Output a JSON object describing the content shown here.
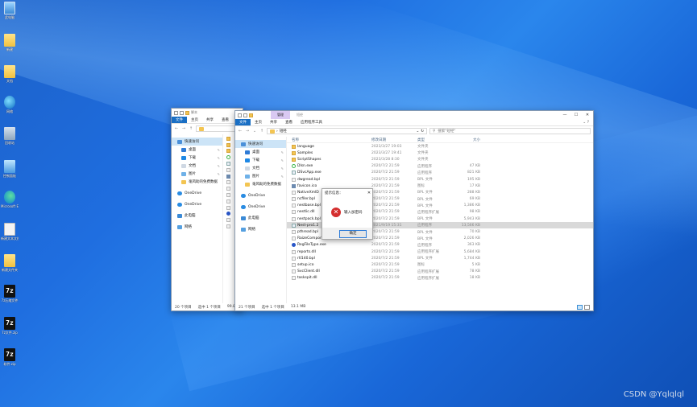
{
  "desktop": {
    "icons": [
      {
        "label": "此电脑",
        "icon": "this-pc-icon"
      },
      {
        "label": "新建",
        "icon": "folder-icon"
      },
      {
        "label": "文档",
        "icon": "folder-icon"
      },
      {
        "label": "网络",
        "icon": "network-icon"
      },
      {
        "label": "回收站",
        "icon": "recycle-bin-icon"
      },
      {
        "label": "控制面板",
        "icon": "control-panel-icon"
      },
      {
        "label": "Microsoft Edge",
        "icon": "edge-icon"
      },
      {
        "label": "新建文本文档.txt",
        "icon": "text-file-icon"
      },
      {
        "label": "新建文件夹",
        "icon": "folder-icon"
      },
      {
        "label": "7z压缩文件",
        "icon": "7z-icon"
      },
      {
        "label": "7z文件.zip",
        "icon": "7z-icon"
      },
      {
        "label": "软件.zip",
        "icon": "7z-icon"
      }
    ]
  },
  "back_window": {
    "title": "脚本",
    "ribbon": [
      "文件",
      "主页",
      "共享",
      "查看"
    ],
    "nav": [
      "快速访问",
      "桌面",
      "下载",
      "文档",
      "图片",
      "毫风助的免费数据",
      "OneDrive",
      "OneDrive",
      "此电脑",
      "网络"
    ],
    "status": {
      "count": "20 个项目",
      "selected": "选中 1 个项目",
      "size": "99.8 KB"
    }
  },
  "front_window": {
    "ctx_tab": "管理",
    "title": "短经",
    "window_controls": {
      "minimize": "—",
      "maximize": "☐",
      "close": "✕"
    },
    "ribbon": [
      "文件",
      "主页",
      "共享",
      "查看",
      "应用程序工具"
    ],
    "ribbon_expand": "⌄ ?",
    "address": {
      "path": "短经",
      "back": "←",
      "forward": "→",
      "dropdown": "⌄",
      "up": "↑",
      "refresh": "↻",
      "separator": "›"
    },
    "search": {
      "placeholder": "搜索\"短经\"",
      "icon": "⚲"
    },
    "nav": [
      {
        "label": "快速访问",
        "icon": "star-icon",
        "kind": "sel"
      },
      {
        "label": "桌面",
        "icon": "desktop-icon",
        "kind": "sub",
        "pin": true
      },
      {
        "label": "下载",
        "icon": "download-icon",
        "kind": "sub",
        "pin": true
      },
      {
        "label": "文档",
        "icon": "documents-icon",
        "kind": "sub",
        "pin": true
      },
      {
        "label": "图片",
        "icon": "pictures-icon",
        "kind": "sub",
        "pin": true
      },
      {
        "label": "毫风助的免费数据",
        "icon": "folder-icon",
        "kind": "sub"
      },
      {
        "label": "OneDrive",
        "icon": "cloud-icon",
        "kind": "top"
      },
      {
        "label": "OneDrive",
        "icon": "cloud-icon",
        "kind": "top"
      },
      {
        "label": "此电脑",
        "icon": "pc-icon",
        "kind": "top"
      },
      {
        "label": "网络",
        "icon": "network-icon",
        "kind": "top"
      }
    ],
    "pin_glyph": "✎",
    "columns": [
      "名称",
      "修改日期",
      "类型",
      "大小"
    ],
    "files": [
      {
        "name": "language",
        "date": "2023/3/27 19:03",
        "type": "文件夹",
        "size": "",
        "icon": "folder"
      },
      {
        "name": "Samples",
        "date": "2023/3/27 19:41",
        "type": "文件夹",
        "size": "",
        "icon": "folder"
      },
      {
        "name": "ScriptShapes",
        "date": "2023/3/28 8:30",
        "type": "文件夹",
        "size": "",
        "icon": "folder"
      },
      {
        "name": "Dlsn.exe",
        "date": "2020/7/2 21:59",
        "type": "应用程序",
        "size": "47 KB",
        "icon": "green"
      },
      {
        "name": "DSvcApp.exe",
        "date": "2020/7/2 21:59",
        "type": "应用程序",
        "size": "821 KB",
        "icon": "exe"
      },
      {
        "name": "dwgread.bpl",
        "date": "2020/7/2 21:59",
        "type": "BPL 文件",
        "size": "195 KB",
        "icon": "dll"
      },
      {
        "name": "favicon.ico",
        "date": "2020/7/2 21:59",
        "type": "图标",
        "size": "17 KB",
        "icon": "ico"
      },
      {
        "name": "NativeXmlD",
        "date": "2020/7/2 21:59",
        "type": "BPL 文件",
        "size": "288 KB",
        "icon": "dll"
      },
      {
        "name": "ncfiler.bpl",
        "date": "2020/7/2 21:59",
        "type": "BPL 文件",
        "size": "69 KB",
        "icon": "dll"
      },
      {
        "name": "nestbase.bpl",
        "date": "2020/7/2 21:59",
        "type": "BPL 文件",
        "size": "1,386 KB",
        "icon": "dll"
      },
      {
        "name": "nestlic.dll",
        "date": "2020/7/2 21:59",
        "type": "应用程序扩展",
        "size": "98 KB",
        "icon": "dll"
      },
      {
        "name": "nestpack.bpl",
        "date": "2020/7/2 21:59",
        "type": "BPL 文件",
        "size": "5,943 KB",
        "icon": "dll"
      },
      {
        "name": "Nest-pro1.2",
        "date": "2021/9/19 15:31",
        "type": "应用程序",
        "size": "13,566 KB",
        "icon": "exe",
        "hl": true
      },
      {
        "name": "pthread.bpl",
        "date": "2020/7/2 21:59",
        "type": "BPL 文件",
        "size": "70 KB",
        "icon": "dll"
      },
      {
        "name": "RaizeComponentsVcl140.bpl",
        "date": "2020/7/2 21:59",
        "type": "BPL 文件",
        "size": "2,026 KB",
        "icon": "dll"
      },
      {
        "name": "RegFileType.exe",
        "date": "2020/7/2 21:59",
        "type": "应用程序",
        "size": "363 KB",
        "icon": "blue"
      },
      {
        "name": "reports.dll",
        "date": "2020/7/2 21:59",
        "type": "应用程序扩展",
        "size": "5,684 KB",
        "icon": "dll"
      },
      {
        "name": "rtl140.bpl",
        "date": "2020/7/2 21:59",
        "type": "BPL 文件",
        "size": "1,744 KB",
        "icon": "dll"
      },
      {
        "name": "setup.ico",
        "date": "2020/7/2 21:59",
        "type": "图标",
        "size": "5 KB",
        "icon": "dll"
      },
      {
        "name": "SvcClient.dll",
        "date": "2020/7/2 21:59",
        "type": "应用程序扩展",
        "size": "78 KB",
        "icon": "dll"
      },
      {
        "name": "taskspit.dll",
        "date": "2020/7/2 21:59",
        "type": "应用程序扩展",
        "size": "18 KB",
        "icon": "dll"
      }
    ],
    "status": {
      "count": "21 个项目",
      "selected": "选中 1 个项目",
      "size": "13.1 MB"
    }
  },
  "dialog": {
    "title": "提示信息：",
    "close": "✕",
    "message": "输入加密码",
    "button": "确定",
    "error_glyph": "✕"
  },
  "watermark": "CSDN @Yqlqlql"
}
